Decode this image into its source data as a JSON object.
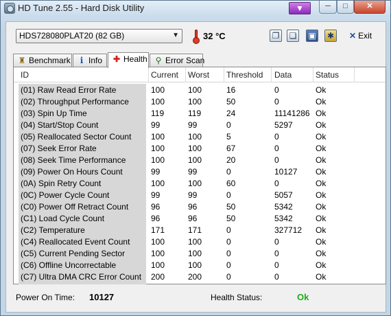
{
  "window": {
    "title": "HD Tune 2.55 - Hard Disk Utility",
    "extra_button_glyph": "▼",
    "minimize_glyph": "─",
    "maximize_glyph": "□",
    "close_glyph": "✕"
  },
  "toolbar": {
    "drive": "HDS728080PLAT20 (82 GB)",
    "temperature": "32 °C",
    "exit_label": "Exit",
    "icons": [
      "copy-icon",
      "copy-all-icon",
      "save-icon",
      "options-icon"
    ]
  },
  "tabs": [
    {
      "label": "Benchmark",
      "icon": "benchmark-icon"
    },
    {
      "label": "Info",
      "icon": "info-icon"
    },
    {
      "label": "Health",
      "icon": "health-cross-icon",
      "active": true
    },
    {
      "label": "Error Scan",
      "icon": "magnifier-icon"
    }
  ],
  "table": {
    "columns": [
      "ID",
      "Current",
      "Worst",
      "Threshold",
      "Data",
      "Status"
    ],
    "rows": [
      {
        "id": "(01) Raw Read Error Rate",
        "current": "100",
        "worst": "100",
        "threshold": "16",
        "data": "0",
        "status": "Ok"
      },
      {
        "id": "(02) Throughput Performance",
        "current": "100",
        "worst": "100",
        "threshold": "50",
        "data": "0",
        "status": "Ok"
      },
      {
        "id": "(03) Spin Up Time",
        "current": "119",
        "worst": "119",
        "threshold": "24",
        "data": "11141286",
        "status": "Ok"
      },
      {
        "id": "(04) Start/Stop Count",
        "current": "99",
        "worst": "99",
        "threshold": "0",
        "data": "5297",
        "status": "Ok"
      },
      {
        "id": "(05) Reallocated Sector Count",
        "current": "100",
        "worst": "100",
        "threshold": "5",
        "data": "0",
        "status": "Ok"
      },
      {
        "id": "(07) Seek Error Rate",
        "current": "100",
        "worst": "100",
        "threshold": "67",
        "data": "0",
        "status": "Ok"
      },
      {
        "id": "(08) Seek Time Performance",
        "current": "100",
        "worst": "100",
        "threshold": "20",
        "data": "0",
        "status": "Ok"
      },
      {
        "id": "(09) Power On Hours Count",
        "current": "99",
        "worst": "99",
        "threshold": "0",
        "data": "10127",
        "status": "Ok"
      },
      {
        "id": "(0A) Spin Retry Count",
        "current": "100",
        "worst": "100",
        "threshold": "60",
        "data": "0",
        "status": "Ok"
      },
      {
        "id": "(0C) Power Cycle Count",
        "current": "99",
        "worst": "99",
        "threshold": "0",
        "data": "5057",
        "status": "Ok"
      },
      {
        "id": "(C0) Power Off Retract Count",
        "current": "96",
        "worst": "96",
        "threshold": "50",
        "data": "5342",
        "status": "Ok"
      },
      {
        "id": "(C1) Load Cycle Count",
        "current": "96",
        "worst": "96",
        "threshold": "50",
        "data": "5342",
        "status": "Ok"
      },
      {
        "id": "(C2) Temperature",
        "current": "171",
        "worst": "171",
        "threshold": "0",
        "data": "327712",
        "status": "Ok"
      },
      {
        "id": "(C4) Reallocated Event Count",
        "current": "100",
        "worst": "100",
        "threshold": "0",
        "data": "0",
        "status": "Ok"
      },
      {
        "id": "(C5) Current Pending Sector",
        "current": "100",
        "worst": "100",
        "threshold": "0",
        "data": "0",
        "status": "Ok"
      },
      {
        "id": "(C6) Offline Uncorrectable",
        "current": "100",
        "worst": "100",
        "threshold": "0",
        "data": "0",
        "status": "Ok"
      },
      {
        "id": "(C7) Ultra DMA CRC Error Count",
        "current": "200",
        "worst": "200",
        "threshold": "0",
        "data": "0",
        "status": "Ok"
      }
    ]
  },
  "footer": {
    "power_on_label": "Power On Time:",
    "power_on_value": "10127",
    "health_label": "Health Status:",
    "health_value": "Ok",
    "health_color": "#1faa1f"
  }
}
